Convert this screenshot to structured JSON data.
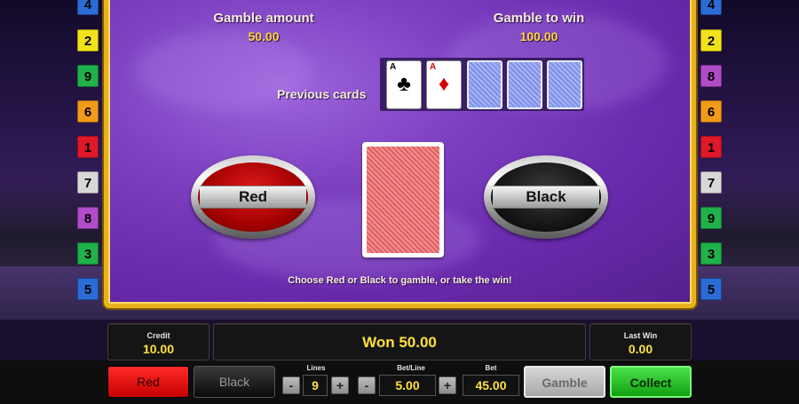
{
  "gamble": {
    "gamble_amount_label": "Gamble amount",
    "gamble_amount_value": "50.00",
    "gamble_to_win_label": "Gamble to win",
    "gamble_to_win_value": "100.00",
    "previous_cards_label": "Previous cards",
    "previous_cards": [
      {
        "rank": "A",
        "suit": "♣",
        "color": "#000000",
        "face_up": true
      },
      {
        "rank": "A",
        "suit": "♦",
        "color": "#d40000",
        "face_up": true
      },
      {
        "face_up": false
      },
      {
        "face_up": false
      },
      {
        "face_up": false
      }
    ],
    "red_button": "Red",
    "black_button": "Black",
    "hint": "Choose Red or Black to gamble, or take the win!"
  },
  "line_numbers": {
    "left": [
      "4",
      "2",
      "9",
      "6",
      "1",
      "7",
      "8",
      "3",
      "5"
    ],
    "right": [
      "4",
      "2",
      "8",
      "6",
      "1",
      "7",
      "9",
      "3",
      "5"
    ],
    "colors": {
      "1": "#e0182a",
      "2": "#f2e21a",
      "3": "#1fb14a",
      "4": "#2a6cd6",
      "5": "#2a6cd6",
      "6": "#f29a1a",
      "7": "#d8d8d8",
      "8": "#b04cc7",
      "9": "#1fb14a"
    }
  },
  "status": {
    "credit_label": "Credit",
    "credit_value": "10.00",
    "message": "Won 50.00",
    "last_win_label": "Last Win",
    "last_win_value": "0.00"
  },
  "controls": {
    "red": "Red",
    "black": "Black",
    "lines_label": "Lines",
    "lines_value": "9",
    "betline_label": "Bet/Line",
    "betline_value": "5.00",
    "bet_label": "Bet",
    "bet_value": "45.00",
    "minus": "-",
    "plus": "+",
    "gamble": "Gamble",
    "collect": "Collect"
  }
}
